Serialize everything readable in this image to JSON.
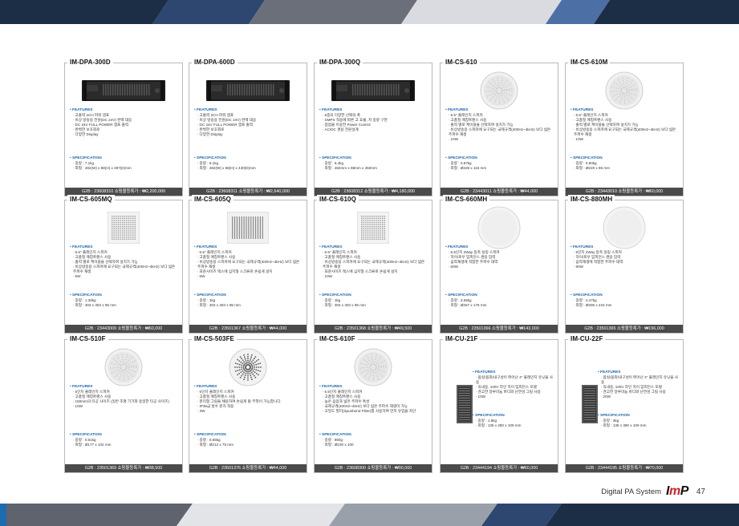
{
  "page": {
    "footer_text": "Digital PA System",
    "logo_left": "I",
    "logo_mid": "m",
    "logo_right": "P",
    "page_number": "47"
  },
  "products": [
    {
      "model": "IM-DPA-300D",
      "image": "rack-amplifier-icon",
      "features": [
        "고출력 2CH 파워 앰프",
        "비상 방송용 전원(DC 24V) 완벽 대응",
        "DC 24V FULL POWER 앰프 출력",
        "완벽한 보호회로",
        "다양한 Display"
      ],
      "specs": [
        "중량 : 7.1kg",
        "외형 : 482(W) x 88(H) x 397(D)mm"
      ],
      "footer": "G2B : 23608310    쇼핑몰등록가 : ₩2,200,000"
    },
    {
      "model": "IM-DPA-600D",
      "image": "rack-amplifier-icon",
      "features": [
        "고출력 2CH 파워 앰프",
        "비상 방송용 전원(DC 24V) 완벽 대응",
        "DC 24V FULL POWER 앰프 출력",
        "완벽한 보호회로",
        "다양한 Display"
      ],
      "specs": [
        "중량 : 8.1kg",
        "외형 : 482(W) x 88(H) x 430(D)mm"
      ],
      "footer": "G2B : 23608311    쇼핑몰등록가 : ₩2,640,000"
    },
    {
      "model": "IM-DPA-300Q",
      "image": "rack-amplifier-icon",
      "features": [
        "8종의 다양한 선택의 폭",
        "SMPS 적용에 따른 고 효율, 저 중량 구현",
        "접점을 이용한 Power Control",
        "AC/DC 겸용 전원설계"
      ],
      "specs": [
        "중량 : 6.4kg",
        "외형 : 482mm x 88mm x 450mm"
      ],
      "footer": "G2B : 23608312    쇼핑몰등록가 : ₩4,180,000"
    },
    {
      "model": "IM-CS-610",
      "image": "round-ceiling-speaker-icon",
      "features": [
        "6.5\" 플레인지 스피커",
        "고품질 매칭트랜스 사용",
        "출력 별로 케이블을 선택하여 설치가 가능",
        "비상방송용 스피커에 요구되는 국제규격(400Hz~4kHz) 보다 넓은 주파수 재생",
        "10W"
      ],
      "specs": [
        "중량 : 0.87kg",
        "외형 : Ø228 x 116 mm"
      ],
      "footer": "G2B : 23443011    쇼핑몰등록가 : ₩44,000"
    },
    {
      "model": "IM-CS-610M",
      "image": "round-ceiling-speaker-icon",
      "features": [
        "6.5\" 플레인지 스피커",
        "고품질 매칭트랜스 사용",
        "출력 별로 케이블을 선택하여 설치가 가능",
        "비상방송용 스피커에 요구되는 국제규격(400Hz~4kHz) 보다 넓은 주파수 재생",
        "10W"
      ],
      "specs": [
        "중량 : 0.90kg",
        "외형 : Ø228 x 96 mm"
      ],
      "footer": "G2B : 23443010    쇼핑몰등록가 : ₩60,000"
    },
    {
      "model": "IM-CS-605MQ",
      "image": "square-grille-speaker-icon",
      "features": [
        "6.5\" 플레인지 스피커",
        "고품질 매칭트랜스 사용",
        "출력 별로 케이블을 선택하여 설치가 가능",
        "비상방송용 스피커에 요구되는 국제규격(400Hz~4kHz) 보다 넓은 주파수 재생",
        "5W"
      ],
      "specs": [
        "중량 : 1.38kg",
        "외형 : 303 x 303 x 95 mm"
      ],
      "footer": "G2B : 23443009    쇼핑몰등록가 : ₩60,000"
    },
    {
      "model": "IM-CS-605Q",
      "image": "square-vent-speaker-icon",
      "features": [
        "6.5\" 플레인지 스피커",
        "고품질 매칭트랜스 사용",
        "비상방송용 스피커에 요구되는 국제규격(400Hz~4kHz) 보다 넓은 주파수 재생",
        "표준사이즈 텍스에 심지형 스크류로 손쉽게 설치",
        "5W"
      ],
      "specs": [
        "중량 : 1kg",
        "외형 : 303 x 303 x 95 mm"
      ],
      "footer": "G2B : 23501367    쇼핑몰등록가 : ₩44,000"
    },
    {
      "model": "IM-CS-610Q",
      "image": "square-grille-speaker-icon",
      "features": [
        "6.5\" 플레인지 스피커",
        "고품질 매칭트랜스 사용",
        "비상방송용 스피커에 요구되는 국제규격(400Hz~4kHz) 보다 넓은 주파수 재생",
        "표준사이즈 텍스에 심지형 스크류로 손쉽게 설치",
        "10W"
      ],
      "specs": [
        "중량 : 1kg",
        "외형 : 303 x 303 x 95 mm"
      ],
      "footer": "G2B : 23501368    쇼핑몰등록가 : ₩49,500"
    },
    {
      "model": "IM-CS-660MH",
      "image": "flat-round-speaker-icon",
      "features": [
        "6.5인치 2Way 동축 실링 스피커",
        "하이/로우 임피던스 겸용 입력",
        "음악재생에 적합한 주파수 대역",
        "60W"
      ],
      "specs": [
        "중량 : 3.65kg",
        "외형 : Ø257 x 176 mm"
      ],
      "footer": "G2B : 23501366    쇼핑몰등록가 : ₩143,000"
    },
    {
      "model": "IM-CS-880MH",
      "image": "flat-round-speaker-icon",
      "features": [
        "8인치 2Way 동축 실링 스피커",
        "하이/로우 임피던스 겸용 입력",
        "음악재생에 적합한 주파수 대역",
        "80W"
      ],
      "specs": [
        "중량 : 4.47kg",
        "외형 : Ø305 x 215 mm"
      ],
      "footer": "G2B : 23501365    쇼핑몰등록가 : ₩196,000"
    },
    {
      "model": "IM-CS-510F",
      "image": "round-ceiling-speaker-icon",
      "features": [
        "5인치 플레인지 스피커",
        "고품질 매칭트랜스 사용",
        "150mm의 타공 사이즈 (일반 조명 기기와 동일한 타공 사이즈)",
        "10W"
      ],
      "specs": [
        "중량 : 0.61kg",
        "외형 : Ø177 x 102 mm"
      ],
      "footer": "G2B : 23501369    쇼핑몰등록가 : ₩38,500"
    },
    {
      "model": "IM-CS-503FE",
      "image": "round-dot-speaker-icon",
      "features": [
        "5인치 플레인지 스피커",
        "고품질 매칭트랜스 사용",
        "분리형 그릴을 채용하여 손쉽게 탈·부착이 가능합니다.",
        "IP35급 방수 준치 적용",
        "3W"
      ],
      "specs": [
        "중량 : 0.65kg",
        "외형 : Ø212 x 75 mm"
      ],
      "footer": "G2B : 23501376    쇼핑몰등록가 : ₩44,000"
    },
    {
      "model": "IM-CS-610F",
      "image": "round-ceiling-speaker-icon",
      "features": [
        "6.5인치 플레인지 스피커",
        "고품질 매칭트랜스 사용",
        "높은 음압과 넓은 주파수 특성",
        "국제규격(400Hz~4kHz) 보다 넓은 주파수 재생이 가능",
        "고밀도 필터(Spunbond Filter)를 사용하여 먼지 유입을 차단"
      ],
      "specs": [
        "중량 : 850g",
        "외형 : Ø230 x 100"
      ],
      "footer": "G2B : 23608300    쇼핑몰등록가 : ₩90,000"
    },
    {
      "model": "IM-CU-21F",
      "image": "column-speaker-icon",
      "features": [
        "옵실/옵외/내구성이 뛰어난 4\" 플레인지 유닛을 사용",
        "옥내용, 100V 라인 하이 임피던스 모델",
        "견고한 알루미늄 바디와 난연성 그릴 사용",
        "10W"
      ],
      "specs": [
        "중량 : 1.8kg",
        "외형 : 135 x 280 x 109 mm"
      ],
      "footer": "G2B : 23444194    쇼핑몰등록가 : ₩60,000"
    },
    {
      "model": "IM-CU-22F",
      "image": "column-speaker-icon",
      "features": [
        "옵실/옵외/내구성이 뛰어난 4\" 플레인지 유닛을 사용",
        "옥내용, 100V 라인 하이 임피던스 모델",
        "견고한 알루미늄 바디와 난연성 그릴 사용",
        "20W"
      ],
      "specs": [
        "중량 : 3kg",
        "외형 : 135 x 390 x 109 mm"
      ],
      "footer": "G2B : 23444195    쇼핑몰등록가 : ₩70,000"
    }
  ],
  "labels": {
    "features": "FEATURES",
    "spec": "SPECIFICATION"
  }
}
